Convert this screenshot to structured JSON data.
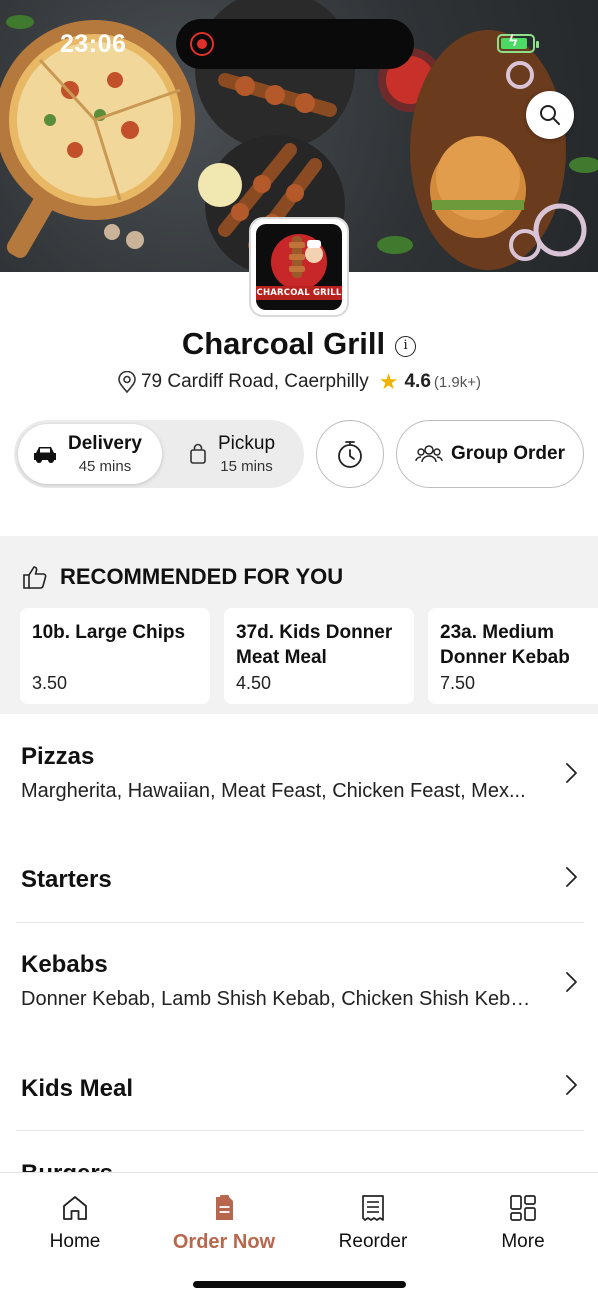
{
  "status_bar": {
    "time": "23:06"
  },
  "restaurant": {
    "name": "Charcoal Grill",
    "logo_text": "CHARCOAL GRILL",
    "address": "79 Cardiff Road, Caerphilly",
    "rating": "4.6",
    "rating_count": "(1.9k+)"
  },
  "order_mode": {
    "delivery": {
      "label": "Delivery",
      "time": "45 mins",
      "selected": true
    },
    "pickup": {
      "label": "Pickup",
      "time": "15 mins",
      "selected": false
    }
  },
  "group_order_label": "Group Order",
  "recommended": {
    "title": "RECOMMENDED FOR YOU",
    "items": [
      {
        "name": "10b. Large Chips",
        "price": "3.50"
      },
      {
        "name": "37d. Kids Donner Meat Meal",
        "price": "4.50"
      },
      {
        "name": "23a. Medium Donner Kebab",
        "price": "7.50"
      }
    ]
  },
  "categories": [
    {
      "name": "Pizzas",
      "description": "Margherita, Hawaiian, Meat Feast, Chicken Feast, Mex..."
    },
    {
      "name": "Starters",
      "description": ""
    },
    {
      "name": "Kebabs",
      "description": "Donner Kebab, Lamb Shish Kebab, Chicken Shish Keba..."
    },
    {
      "name": "Kids Meal",
      "description": ""
    },
    {
      "name": "Burgers",
      "description": ""
    }
  ],
  "bottom_nav": {
    "items": [
      {
        "label": "Home",
        "icon": "home-icon"
      },
      {
        "label": "Order Now",
        "icon": "order-icon",
        "active": true
      },
      {
        "label": "Reorder",
        "icon": "receipt-icon"
      },
      {
        "label": "More",
        "icon": "grid-icon"
      }
    ]
  },
  "colors": {
    "accent": "#b8674f",
    "star": "#f0b400",
    "recommended_bg": "#f2f2f2"
  }
}
